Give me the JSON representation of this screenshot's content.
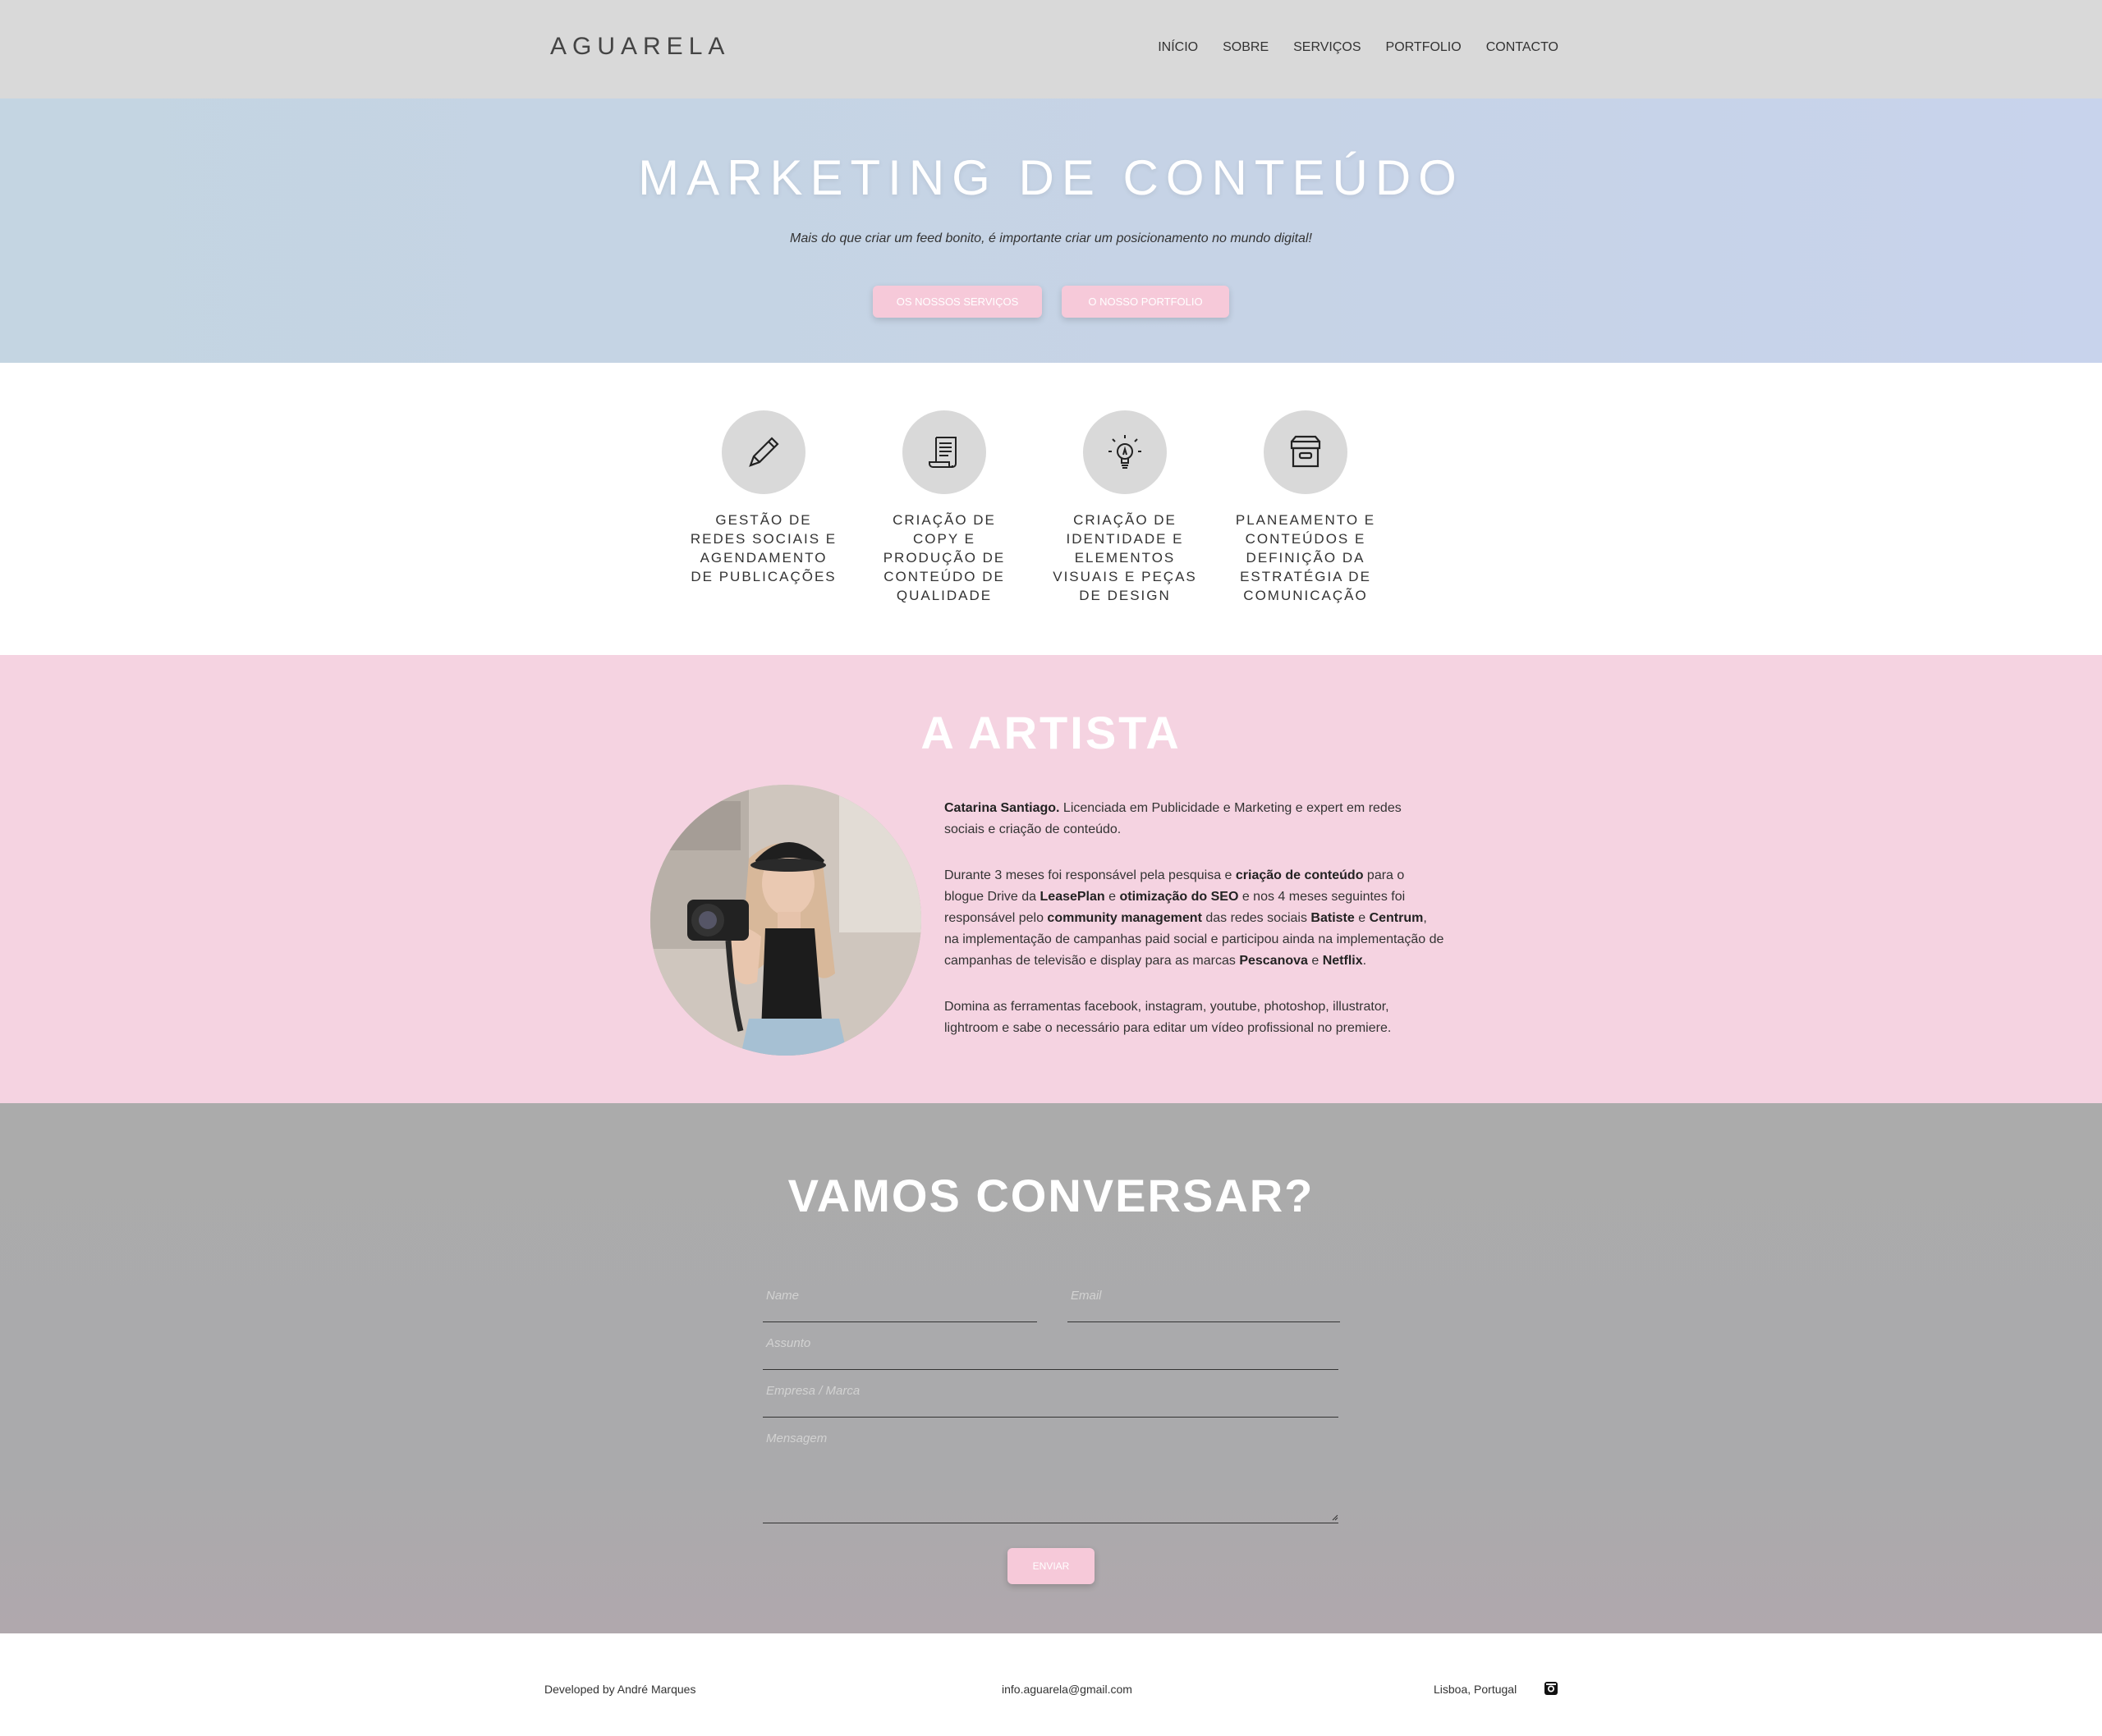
{
  "nav": {
    "logo": "AGUARELA",
    "items": [
      "INÍCIO",
      "SOBRE",
      "SERVIÇOS",
      "PORTFOLIO",
      "CONTACTO"
    ]
  },
  "hero": {
    "title": "MARKETING DE CONTEÚDO",
    "subtitle": "Mais do que criar um feed bonito, é importante criar um posicionamento no mundo digital!",
    "buttons": [
      "OS NOSSOS SERVIÇOS",
      "O NOSSO PORTFOLIO"
    ],
    "accent_color": "#f6c9d9"
  },
  "services": [
    {
      "icon": "pencil-icon",
      "label": "GESTÃO DE REDES SOCIAIS E AGENDAMENTO DE PUBLICAÇÕES"
    },
    {
      "icon": "scroll-icon",
      "label": "CRIAÇÃO DE COPY E PRODUÇÃO DE CONTEÚDO DE QUALIDADE"
    },
    {
      "icon": "lightbulb-icon",
      "label": "CRIAÇÃO DE IDENTIDADE E ELEMENTOS VISUAIS E PEÇAS DE DESIGN"
    },
    {
      "icon": "archive-box-icon",
      "label": "PLANEAMENTO E CONTEÚDOS E DEFINIÇÃO DA ESTRATÉGIA DE COMUNICAÇÃO"
    }
  ],
  "artist": {
    "title": "A ARTISTA",
    "bio_html": [
      "<b>Catarina Santiago.</b> Licenciada em Publicidade e Marketing e expert em redes sociais e criação de conteúdo.",
      "Durante 3 meses foi responsável pela pesquisa e <b>criação de conteúdo</b> para o blogue Drive da <b>LeasePlan</b> e <b>otimização do SEO</b> e nos 4 meses seguintes foi responsável pelo <b>community management</b> das redes sociais <b>Batiste</b> e <b>Centrum</b>, na implementação de campanhas paid social e participou ainda na implementação de campanhas de televisão e display para as marcas <b>Pescanova</b> e <b>Netflix</b>.",
      "Domina as ferramentas facebook, instagram, youtube, photoshop, illustrator, lightroom e sabe o necessário para editar um vídeo profissional no premiere."
    ]
  },
  "contact": {
    "title": "VAMOS CONVERSAR?",
    "placeholders": {
      "name": "Name",
      "email": "Email",
      "subject": "Assunto",
      "company": "Empresa / Marca",
      "message": "Mensagem"
    },
    "send_label": "ENVIAR"
  },
  "footer": {
    "developer": "Developed by André Marques",
    "email": "info.aguarela@gmail.com",
    "location": "Lisboa, Portugal",
    "social_icon": "instagram-icon"
  }
}
